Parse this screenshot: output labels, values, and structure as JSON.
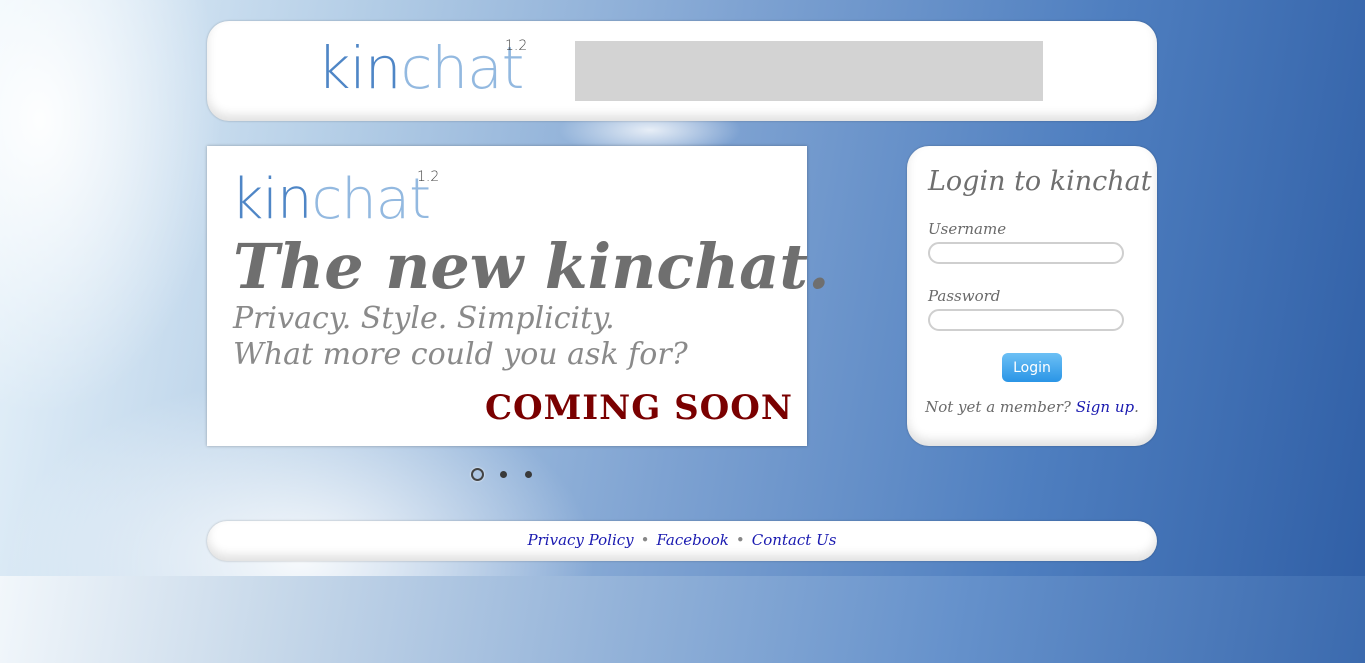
{
  "header": {
    "logo": {
      "kin": "kin",
      "chat": "chat",
      "version": "1.2"
    }
  },
  "slide": {
    "logo": {
      "kin": "kin",
      "chat": "chat",
      "version": "1.2"
    },
    "headline": "The new kinchat.",
    "subline_1": "Privacy. Style. Simplicity.",
    "subline_2": "What more could you ask for?",
    "coming_soon": "COMING SOON"
  },
  "carousel": {
    "active_index": 1,
    "count": 3
  },
  "login": {
    "title": "Login to kinchat",
    "username_label": "Username",
    "username_value": "",
    "password_label": "Password",
    "password_value": "",
    "button_label": "Login",
    "signup_prompt": "Not yet a member?",
    "signup_link": "Sign up",
    "signup_suffix": "."
  },
  "footer": {
    "links": [
      "Privacy Policy",
      "Facebook",
      "Contact Us"
    ],
    "separator": "•"
  },
  "colors": {
    "logo_kin": "#4f86c6",
    "logo_chat": "#93b9e0",
    "coming_soon": "#7a0000",
    "link": "#1a1ab0",
    "login_button": "#2a95e6"
  }
}
